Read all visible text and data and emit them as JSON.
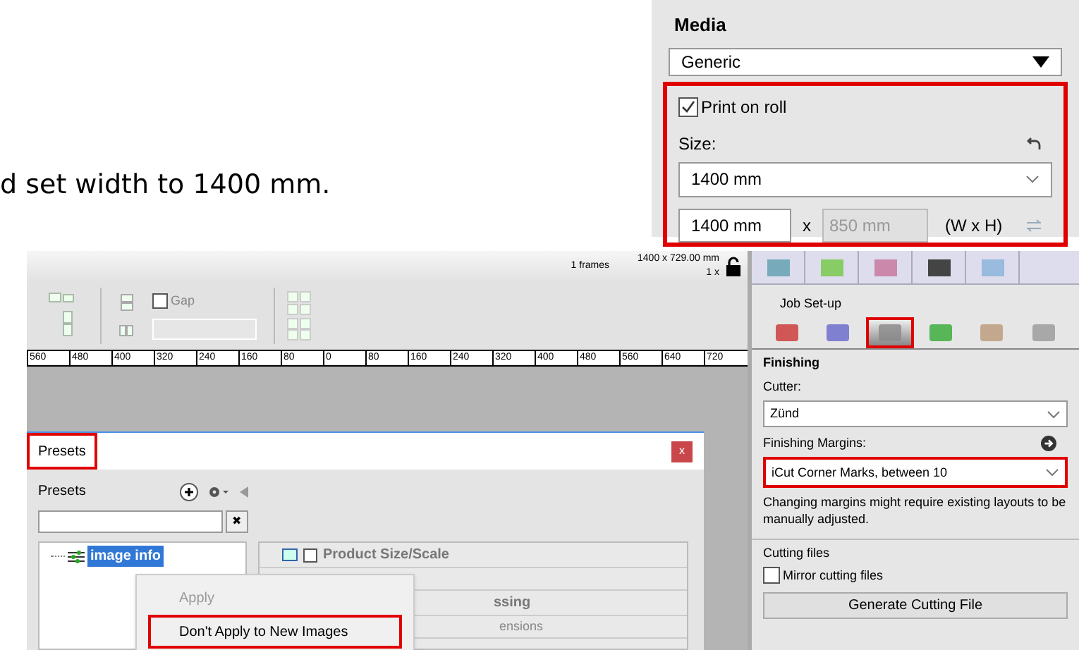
{
  "instruction_text": "d set width to 1400 mm.",
  "media_panel": {
    "title": "Media",
    "media_select": "Generic",
    "highlighted": true,
    "print_on_roll": {
      "label": "Print on roll",
      "checked": true
    },
    "size_label": "Size:",
    "size_select": "1400 mm",
    "width_value": "1400 mm",
    "times": "x",
    "height_value": "850 mm",
    "height_disabled": true,
    "dims_label": "(W x H)"
  },
  "app": {
    "status": {
      "frames": "1 frames",
      "dimensions": "1400 x 729.00 mm",
      "copies": "1 x"
    },
    "toolbar": {
      "gap": {
        "label": "Gap",
        "checked": false
      }
    },
    "ruler": [
      "560",
      "480",
      "400",
      "320",
      "240",
      "160",
      "80",
      "0",
      "80",
      "160",
      "240",
      "320",
      "400",
      "480",
      "560",
      "640",
      "720"
    ],
    "presets_dialog": {
      "title": "Presets",
      "title_highlighted": true,
      "close": "x",
      "section_label": "Presets",
      "clear": "✖",
      "tree": [
        {
          "label": "image info",
          "selected": true
        }
      ],
      "settings": [
        {
          "kind": "header",
          "label": "Product Size/Scale",
          "checked": false
        },
        {
          "kind": "row"
        },
        {
          "kind": "header",
          "label": "ssing"
        },
        {
          "kind": "row",
          "label": "ensions"
        }
      ],
      "context_menu": [
        {
          "label": "Apply",
          "disabled": true,
          "highlighted": false
        },
        {
          "label": "Don't Apply to New Images",
          "disabled": false,
          "highlighted": true
        }
      ]
    },
    "side_panel": {
      "group_label": "Job Set-up",
      "tools": [
        {
          "selected": false
        },
        {
          "selected": false
        },
        {
          "selected": true
        },
        {
          "selected": false
        },
        {
          "selected": false
        },
        {
          "selected": false
        }
      ],
      "section": "Finishing",
      "cutter_label": "Cutter:",
      "cutter": "Zünd",
      "margins_label": "Finishing Margins:",
      "margins": "iCut Corner Marks, between 10",
      "margins_highlighted": true,
      "note": "Changing margins might require existing layouts to be manually adjusted.",
      "cutting_label": "Cutting files",
      "mirror": {
        "label": "Mirror cutting files",
        "checked": false
      },
      "generate": "Generate Cutting File"
    }
  }
}
